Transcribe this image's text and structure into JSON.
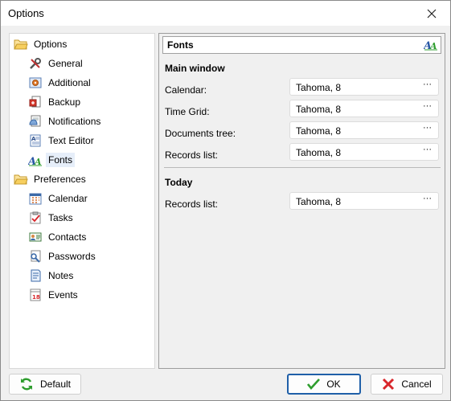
{
  "window": {
    "title": "Options"
  },
  "tree": {
    "groups": [
      {
        "label": "Options"
      },
      {
        "label": "Preferences"
      }
    ],
    "items": [
      {
        "label": "General",
        "icon": "wrench-icon"
      },
      {
        "label": "Additional",
        "icon": "gear-icon"
      },
      {
        "label": "Backup",
        "icon": "backup-icon"
      },
      {
        "label": "Notifications",
        "icon": "notifications-icon"
      },
      {
        "label": "Text Editor",
        "icon": "text-editor-icon"
      },
      {
        "label": "Fonts",
        "icon": "fonts-icon",
        "selected": true
      },
      {
        "label": "Calendar",
        "icon": "calendar-icon"
      },
      {
        "label": "Tasks",
        "icon": "tasks-icon"
      },
      {
        "label": "Contacts",
        "icon": "contacts-icon"
      },
      {
        "label": "Passwords",
        "icon": "passwords-icon"
      },
      {
        "label": "Notes",
        "icon": "notes-icon"
      },
      {
        "label": "Events",
        "icon": "events-icon"
      }
    ]
  },
  "panel": {
    "title": "Fonts",
    "main_window": {
      "heading": "Main window",
      "fields": [
        {
          "label": "Calendar:",
          "value": "Tahoma, 8"
        },
        {
          "label": "Time Grid:",
          "value": "Tahoma, 8"
        },
        {
          "label": "Documents tree:",
          "value": "Tahoma, 8"
        },
        {
          "label": "Records list:",
          "value": "Tahoma, 8"
        }
      ]
    },
    "today": {
      "heading": "Today",
      "fields": [
        {
          "label": "Records list:",
          "value": "Tahoma, 8"
        }
      ]
    },
    "browse_label": "···"
  },
  "buttons": {
    "default": "Default",
    "ok": "OK",
    "cancel": "Cancel"
  },
  "colors": {
    "accent": "#1f5fa8",
    "ok_check": "#2e9d2e",
    "cancel_x": "#d8262b",
    "selection": "#e6eef9"
  }
}
